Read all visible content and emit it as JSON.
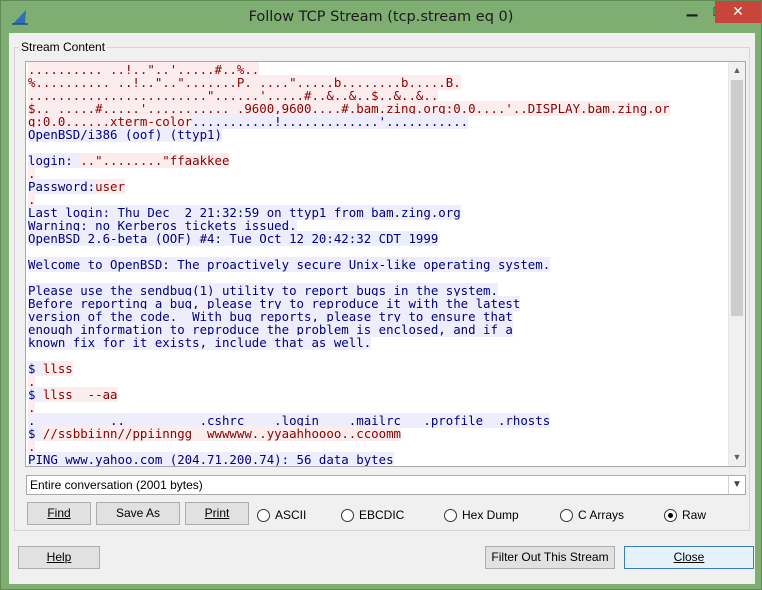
{
  "window": {
    "title": "Follow TCP Stream (tcp.stream eq 0)",
    "minimize_glyph": "▁",
    "maximize_glyph": "☐",
    "close_glyph": "✕",
    "icon": "wireshark-fin-icon"
  },
  "group": {
    "label": "Stream Content"
  },
  "stream": {
    "lines": [
      {
        "parts": [
          {
            "dir": "client",
            "text": ".......... ..!..\"..'.....#..%.."
          }
        ]
      },
      {
        "parts": [
          {
            "dir": "client",
            "text": "%.......... ..!..\"..\".......P. ....\".....b........b.....B."
          }
        ]
      },
      {
        "parts": [
          {
            "dir": "client",
            "text": "........................\"......'.....#..&..&..$..&..&.."
          }
        ]
      },
      {
        "parts": [
          {
            "dir": "client",
            "text": "$.. .....#.....'........... .9600,9600....#.bam.zing.org:0.0....'..DISPLAY.bam.zing.or"
          }
        ]
      },
      {
        "parts": [
          {
            "dir": "client",
            "text": "g:0.0......xterm-color"
          },
          {
            "dir": "server",
            "text": "...........!.............'..........."
          }
        ]
      },
      {
        "parts": [
          {
            "dir": "server",
            "text": "OpenBSD/i386 (oof) (ttyp1)"
          }
        ]
      },
      {
        "parts": [
          {
            "dir": "none",
            "text": ""
          }
        ]
      },
      {
        "parts": [
          {
            "dir": "server",
            "text": "login: "
          },
          {
            "dir": "client",
            "text": "..\"........\"ffaakkee"
          }
        ]
      },
      {
        "parts": [
          {
            "dir": "client",
            "text": "."
          }
        ]
      },
      {
        "parts": [
          {
            "dir": "server",
            "text": "Password:"
          },
          {
            "dir": "client",
            "text": "user"
          }
        ]
      },
      {
        "parts": [
          {
            "dir": "client",
            "text": "."
          }
        ]
      },
      {
        "parts": [
          {
            "dir": "server",
            "text": "Last login: Thu Dec  2 21:32:59 on ttyp1 from bam.zing.org"
          }
        ]
      },
      {
        "parts": [
          {
            "dir": "server",
            "text": "Warning: no Kerberos tickets issued."
          }
        ]
      },
      {
        "parts": [
          {
            "dir": "server",
            "text": "OpenBSD 2.6-beta (OOF) #4: Tue Oct 12 20:42:32 CDT 1999"
          }
        ]
      },
      {
        "parts": [
          {
            "dir": "none",
            "text": ""
          }
        ]
      },
      {
        "parts": [
          {
            "dir": "server",
            "text": "Welcome to OpenBSD: The proactively secure Unix-like operating system."
          }
        ]
      },
      {
        "parts": [
          {
            "dir": "none",
            "text": ""
          }
        ]
      },
      {
        "parts": [
          {
            "dir": "server",
            "text": "Please use the sendbug(1) utility to report bugs in the system."
          }
        ]
      },
      {
        "parts": [
          {
            "dir": "server",
            "text": "Before reporting a bug, please try to reproduce it with the latest"
          }
        ]
      },
      {
        "parts": [
          {
            "dir": "server",
            "text": "version of the code.  With bug reports, please try to ensure that"
          }
        ]
      },
      {
        "parts": [
          {
            "dir": "server",
            "text": "enough information to reproduce the problem is enclosed, and if a"
          }
        ]
      },
      {
        "parts": [
          {
            "dir": "server",
            "text": "known fix for it exists, include that as well."
          }
        ]
      },
      {
        "parts": [
          {
            "dir": "none",
            "text": ""
          }
        ]
      },
      {
        "parts": [
          {
            "dir": "server",
            "text": "$ "
          },
          {
            "dir": "client",
            "text": "llss"
          }
        ]
      },
      {
        "parts": [
          {
            "dir": "client",
            "text": "."
          }
        ]
      },
      {
        "parts": [
          {
            "dir": "server",
            "text": "$ "
          },
          {
            "dir": "client",
            "text": "llss  --aa"
          }
        ]
      },
      {
        "parts": [
          {
            "dir": "client",
            "text": "."
          }
        ]
      },
      {
        "parts": [
          {
            "dir": "server",
            "text": ".          ..          .cshrc    .login    .mailrc   .profile  .rhosts"
          }
        ]
      },
      {
        "parts": [
          {
            "dir": "server",
            "text": "$ "
          },
          {
            "dir": "client",
            "text": "//ssbbiinn//ppiinngg  wwwwww..yyaahhoooo..ccoomm"
          }
        ]
      },
      {
        "parts": [
          {
            "dir": "client",
            "text": "."
          }
        ]
      },
      {
        "parts": [
          {
            "dir": "server",
            "text": "PING www.yahoo.com (204.71.200.74): 56 data bytes"
          }
        ]
      }
    ]
  },
  "conversation_select": {
    "value": "Entire conversation (2001 bytes)"
  },
  "buttons": {
    "find": "Find",
    "save_as": "Save As",
    "print": "Print",
    "help": "Help",
    "filter_out": "Filter Out This Stream",
    "close": "Close"
  },
  "formats": [
    {
      "label": "ASCII",
      "checked": false
    },
    {
      "label": "EBCDIC",
      "checked": false
    },
    {
      "label": "Hex Dump",
      "checked": false
    },
    {
      "label": "C Arrays",
      "checked": false
    },
    {
      "label": "Raw",
      "checked": true
    }
  ],
  "colors": {
    "client_text": "#8b0000",
    "client_bg": "#fbeded",
    "server_text": "#00007f",
    "server_bg": "#ededfb",
    "titlebar": "#7fae73",
    "close_button": "#c7453a"
  }
}
